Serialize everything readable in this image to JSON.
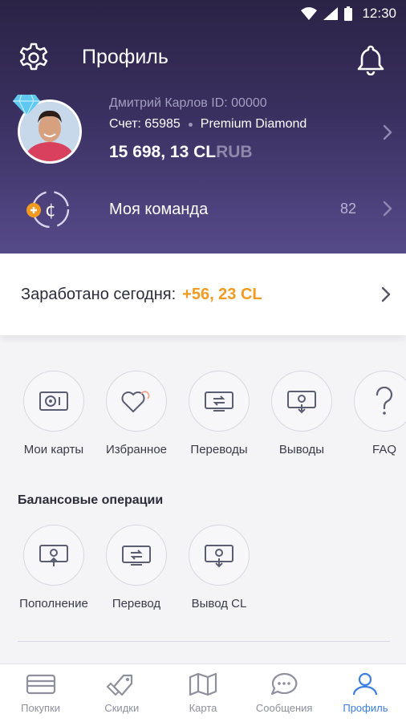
{
  "status_bar": {
    "time": "12:30"
  },
  "header": {
    "title": "Профиль",
    "user": {
      "name_id": "Дмитрий Карлов  ID: 00000",
      "account": "Счет: 65985",
      "tier": "Premium Diamond",
      "balance_amount": "15 698, 13 CL",
      "balance_currency": "RUB"
    },
    "team": {
      "label": "Моя команда",
      "count": "82"
    }
  },
  "earned": {
    "label": "Заработано сегодня:",
    "value": "+56, 23 CL"
  },
  "quick_actions": [
    {
      "label": "Мои карты",
      "icon": "card-icon"
    },
    {
      "label": "Избранное",
      "icon": "hearts-icon"
    },
    {
      "label": "Переводы",
      "icon": "transfer-icon"
    },
    {
      "label": "Выводы",
      "icon": "withdraw-icon"
    },
    {
      "label": "FAQ",
      "icon": "question-icon"
    }
  ],
  "balance_ops": {
    "title": "Балансовые операции",
    "items": [
      {
        "label": "Пополнение",
        "icon": "deposit-icon"
      },
      {
        "label": "Перевод",
        "icon": "transfer-icon"
      },
      {
        "label": "Вывод CL",
        "icon": "withdraw-icon"
      }
    ]
  },
  "bottom_nav": [
    {
      "label": "Покупки",
      "icon": "wallet-icon"
    },
    {
      "label": "Скидки",
      "icon": "tag-icon"
    },
    {
      "label": "Карта",
      "icon": "map-icon"
    },
    {
      "label": "Сообщения",
      "icon": "chat-icon"
    },
    {
      "label": "Профиль",
      "icon": "user-icon",
      "active": true
    }
  ],
  "colors": {
    "accent": "#3b7de3",
    "earned": "#f39a21",
    "header_top": "#2b2346",
    "header_bottom": "#564b8a"
  }
}
